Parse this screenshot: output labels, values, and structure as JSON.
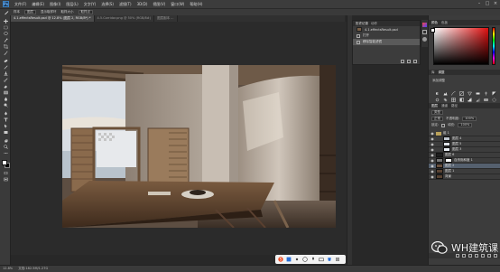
{
  "app": {
    "logo": "Ps",
    "menu": [
      "文件(F)",
      "编辑(E)",
      "图像(I)",
      "图层(L)",
      "文字(Y)",
      "选择(S)",
      "滤镜(T)",
      "3D(D)",
      "视图(V)",
      "窗口(W)",
      "帮助(H)"
    ]
  },
  "options": {
    "sample_label": "样本",
    "sample_value": "图层",
    "checkbox_label": "显示取样环",
    "size_label": "取样大小",
    "size_value": "取样点"
  },
  "tabs": [
    {
      "label": "4.1.effectsResult.psd @ 12.8% (图层 2, RGB/8*) *",
      "active": true
    },
    {
      "label": "4.5.Corridor.png @ 50% (RGB/8#)",
      "active": false
    },
    {
      "label": "图层副本 ...",
      "active": false
    }
  ],
  "history": {
    "tabs": [
      "历史记录",
      "动作"
    ],
    "snapshot": "4.1.effectsResult.psd",
    "items": [
      {
        "label": "打开",
        "selected": false
      },
      {
        "label": "移除智能滤镜",
        "selected": true
      }
    ]
  },
  "color_panel": {
    "tabs": [
      "颜色",
      "色板"
    ],
    "foreground": "#ffffff",
    "background": "#000000",
    "accent": "#e01010"
  },
  "adjust_panel": {
    "tabs": [
      "库",
      "调整"
    ],
    "label": "添加调整",
    "icons": [
      "brightness-icon",
      "levels-icon",
      "curves-icon",
      "exposure-icon",
      "vibrance-icon",
      "hue-icon",
      "balance-icon",
      "bw-icon",
      "photo-filter-icon",
      "channel-mixer-icon",
      "lookup-icon",
      "invert-icon",
      "posterize-icon",
      "threshold-icon",
      "gradient-map-icon",
      "selective-color-icon"
    ]
  },
  "layers": {
    "tabs": [
      "图层",
      "通道",
      "路径"
    ],
    "kind": "类型",
    "blend": "正常",
    "opacity_label": "不透明度:",
    "opacity_value": "100%",
    "lock_label": "锁定:",
    "fill_label": "填充:",
    "fill_value": "100%",
    "rows": [
      {
        "name": "组 1",
        "thumb": "#4a4a4a",
        "selected": false
      },
      {
        "name": "图层 4",
        "thumb": "#bfc6cf",
        "selected": false
      },
      {
        "name": "图层 5",
        "thumb": "#dfe3e8",
        "selected": false
      },
      {
        "name": "图层 3",
        "thumb": "#e9eef4",
        "selected": false
      },
      {
        "name": "图层 6",
        "thumb": "#1e1e1e",
        "selected": false
      },
      {
        "name": "自然饱和度 1",
        "thumb": "#ffffff",
        "selected": false
      },
      {
        "name": "图层 2",
        "thumb": "#6b5240",
        "selected": true
      },
      {
        "name": "图层 1",
        "thumb": "#5a4434",
        "selected": false
      },
      {
        "name": "背景",
        "thumb": "#584232",
        "selected": false
      }
    ]
  },
  "status": {
    "zoom": "12.8%",
    "doc": "文档:182.5M/1.27G"
  },
  "watermark": {
    "text": "WH建筑课"
  }
}
